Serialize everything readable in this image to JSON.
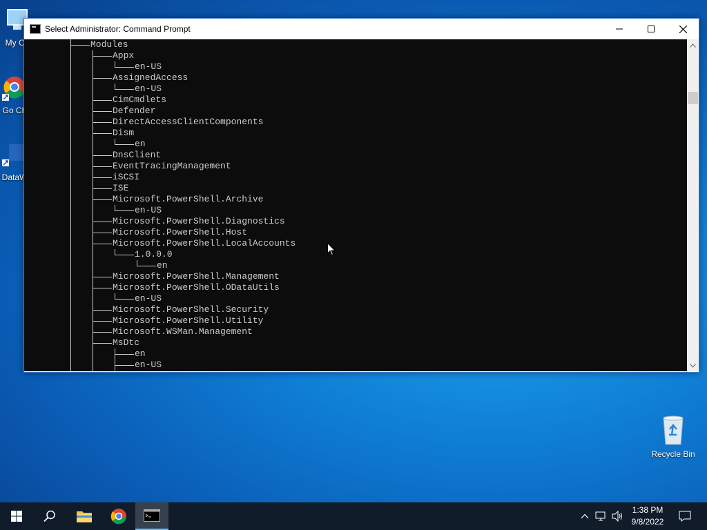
{
  "desktop": {
    "icons": [
      {
        "label": "My Co"
      },
      {
        "label": "Go Ch"
      },
      {
        "label": "DataW"
      },
      {
        "label": "Recycle Bin"
      }
    ]
  },
  "window": {
    "title": "Select Administrator: Command Prompt",
    "controls": {
      "minimize": "—",
      "maximize": "☐",
      "close": "✕"
    }
  },
  "console": {
    "lines": [
      "Modules",
      "Appx",
      "en-US",
      "AssignedAccess",
      "en-US",
      "CimCmdlets",
      "Defender",
      "DirectAccessClientComponents",
      "Dism",
      "en",
      "DnsClient",
      "EventTracingManagement",
      "iSCSI",
      "ISE",
      "Microsoft.PowerShell.Archive",
      "en-US",
      "Microsoft.PowerShell.Diagnostics",
      "Microsoft.PowerShell.Host",
      "Microsoft.PowerShell.LocalAccounts",
      "1.0.0.0",
      "en",
      "Microsoft.PowerShell.Management",
      "Microsoft.PowerShell.ODataUtils",
      "en-US",
      "Microsoft.PowerShell.Security",
      "Microsoft.PowerShell.Utility",
      "Microsoft.WSMan.Management",
      "MsDtc",
      "en",
      "en-US"
    ]
  },
  "taskbar": {
    "items": [
      "start-icon",
      "search-icon",
      "file-explorer-icon",
      "chrome-icon",
      "command-prompt-icon"
    ],
    "tray": {
      "time": "1:38 PM",
      "date": "9/8/2022"
    }
  }
}
